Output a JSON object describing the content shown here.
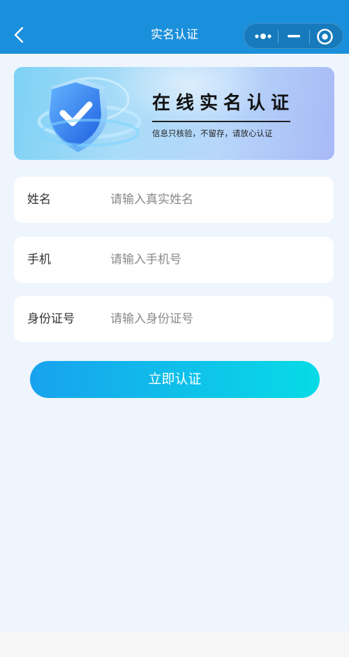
{
  "header": {
    "title": "实名认证",
    "back_icon": "chevron-left-icon",
    "capsule": {
      "more_icon": "more-dots-icon",
      "minimize_icon": "minimize-icon",
      "close_icon": "target-circle-icon"
    }
  },
  "banner": {
    "title": "在线实名认证",
    "subtitle": "信息只核验，不留存，请放心认证",
    "illustration": "shield-check-icon"
  },
  "form": {
    "fields": [
      {
        "label": "姓名",
        "placeholder": "请输入真实姓名",
        "value": ""
      },
      {
        "label": "手机",
        "placeholder": "请输入手机号",
        "value": ""
      },
      {
        "label": "身份证号",
        "placeholder": "请输入身份证号",
        "value": ""
      }
    ]
  },
  "submit": {
    "label": "立即认证"
  },
  "colors": {
    "header_bg": "#1a8fdb",
    "page_bg": "#eef5fd",
    "button_start": "#18a2ee",
    "button_end": "#07dbe6"
  }
}
